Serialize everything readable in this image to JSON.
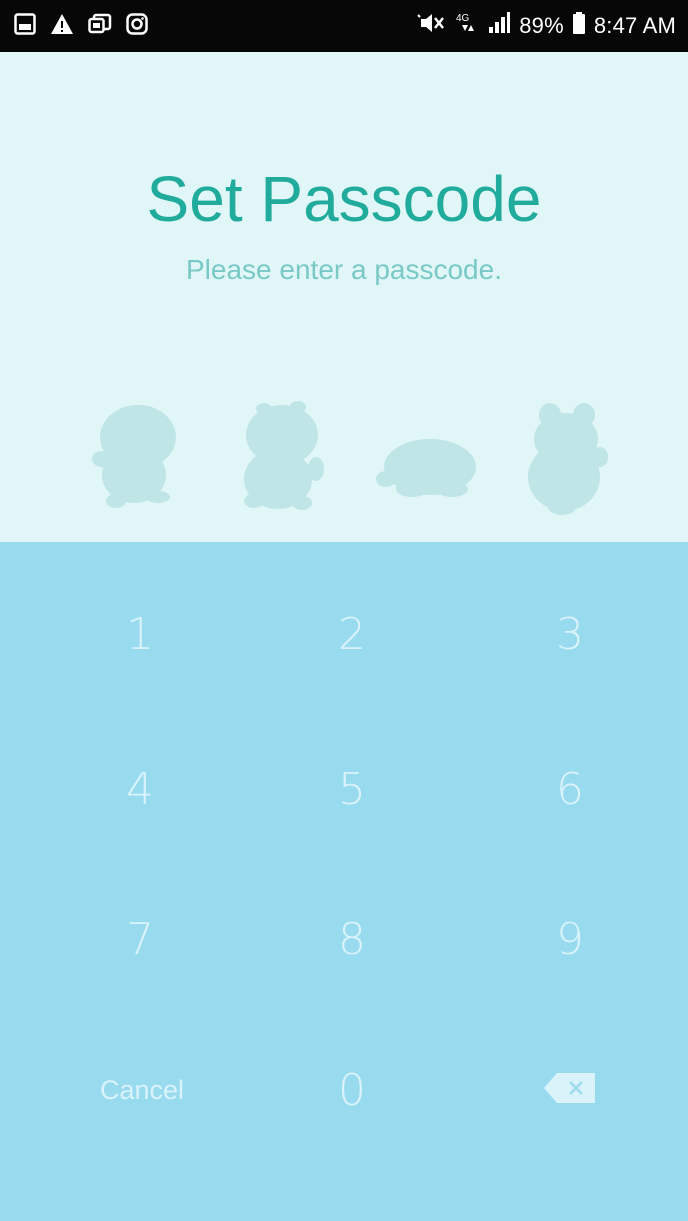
{
  "status_bar": {
    "left_icons": [
      "gallery-icon",
      "warning-icon",
      "cast-icon",
      "instagram-icon"
    ],
    "right_icons": [
      "mute-icon",
      "network-4g-icon",
      "signal-icon",
      "battery-icon"
    ],
    "network": "4G",
    "battery": "89%",
    "time": "8:47 AM"
  },
  "header": {
    "title": "Set Passcode",
    "subtitle": "Please enter a passcode."
  },
  "pin": {
    "slots": [
      "character-placeholder-1-icon",
      "character-placeholder-2-icon",
      "character-placeholder-3-icon",
      "character-placeholder-4-icon"
    ],
    "entered_digits": 0
  },
  "keypad": {
    "keys": [
      "1",
      "2",
      "3",
      "4",
      "5",
      "6",
      "7",
      "8",
      "9",
      "Cancel",
      "0"
    ],
    "backspace_icon": "backspace-icon"
  },
  "colors": {
    "status_bar_bg": "#070707",
    "top_bg": "#e1f6f7",
    "title": "#21ab9c",
    "subtitle": "#79c9c6",
    "placeholder": "#bfe5e6",
    "keypad_bg": "#99dbee",
    "key_text": "#daf3fb"
  }
}
